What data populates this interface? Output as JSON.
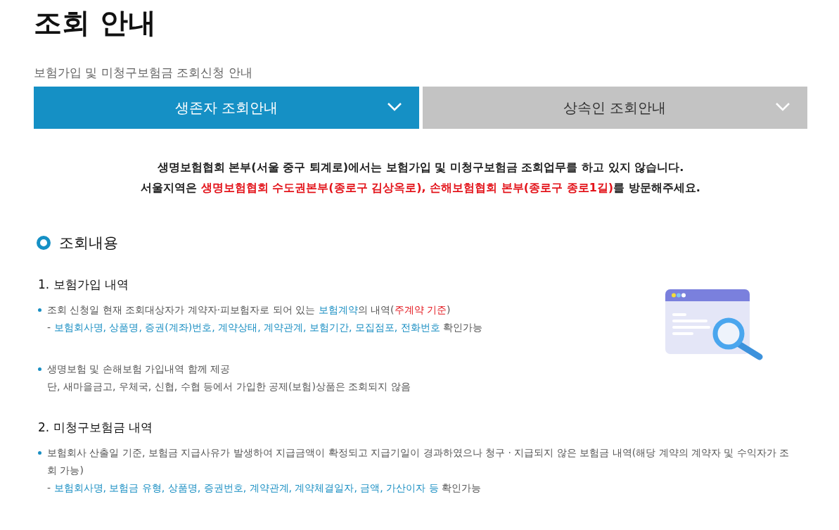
{
  "page_title": "조회 안내",
  "subtitle": "보험가입 및 미청구보험금 조회신청 안내",
  "tabs": [
    {
      "label": "생존자 조회안내",
      "selected": true
    },
    {
      "label": "상속인 조회안내",
      "selected": false
    }
  ],
  "notice": [
    [
      {
        "text": "생명보험협회 본부(서울 중구 퇴계로)에서는 보험가입 및 미청구보험금 조회업무를 하고 있지 않습니다.",
        "color": "#222222"
      }
    ],
    [
      {
        "text": "서울지역은 ",
        "color": "#222222"
      },
      {
        "text": "생명보험협회 수도권본부(종로구 김상옥로), 손해보험협회 본부(종로구 종로1길)",
        "color": "#e3141b"
      },
      {
        "text": "를 방문해주세요.",
        "color": "#222222"
      }
    ]
  ],
  "section_heading": "조회내용",
  "items": [
    {
      "title": "1. 보험가입 내역",
      "illustration": true,
      "bullets": [
        [
          [
            {
              "text": "조회 신청일 현재 조회대상자가 계약자·피보험자로 되어 있는 ",
              "color": "#555555"
            },
            {
              "text": "보험계약",
              "color": "#1a8fc3"
            },
            {
              "text": "의 내역(",
              "color": "#555555"
            },
            {
              "text": "주계약 기준",
              "color": "#e3141b"
            },
            {
              "text": ")",
              "color": "#555555"
            }
          ],
          [
            {
              "text": "- ",
              "color": "#555555"
            },
            {
              "text": "보험회사명, 상품명, 증권(계좌)번호, 계약상태, 계약관계, 보험기간, 모집점포, 전화번호",
              "color": "#1a8fc3"
            },
            {
              "text": " 확인가능",
              "color": "#555555"
            }
          ]
        ],
        [
          [
            {
              "text": "생명보험 및 손해보험 가입내역 함께 제공",
              "color": "#555555"
            }
          ],
          [
            {
              "text": "단, 새마을금고, 우체국, 신협, 수협 등에서 가입한 공제(보험)상품은 조회되지 않음",
              "color": "#555555"
            }
          ]
        ]
      ]
    },
    {
      "title": "2. 미청구보험금 내역",
      "illustration": false,
      "bullets": [
        [
          [
            {
              "text": "보험회사 산출일 기준, 보험금 지급사유가 발생하여 지급금액이 확정되고 지급기일이 경과하였으나 청구 · 지급되지 않은 보험금 내역(해당 계약의 계약자 및 수익자가 조회 가능)",
              "color": "#555555"
            }
          ],
          [
            {
              "text": "- ",
              "color": "#555555"
            },
            {
              "text": "보험회사명, 보험금 유형, 상품명, 증권번호, 계약관계, 계약체결일자, 금액, 가산이자 등",
              "color": "#1a8fc3"
            },
            {
              "text": " 확인가능",
              "color": "#555555"
            }
          ]
        ]
      ]
    }
  ]
}
